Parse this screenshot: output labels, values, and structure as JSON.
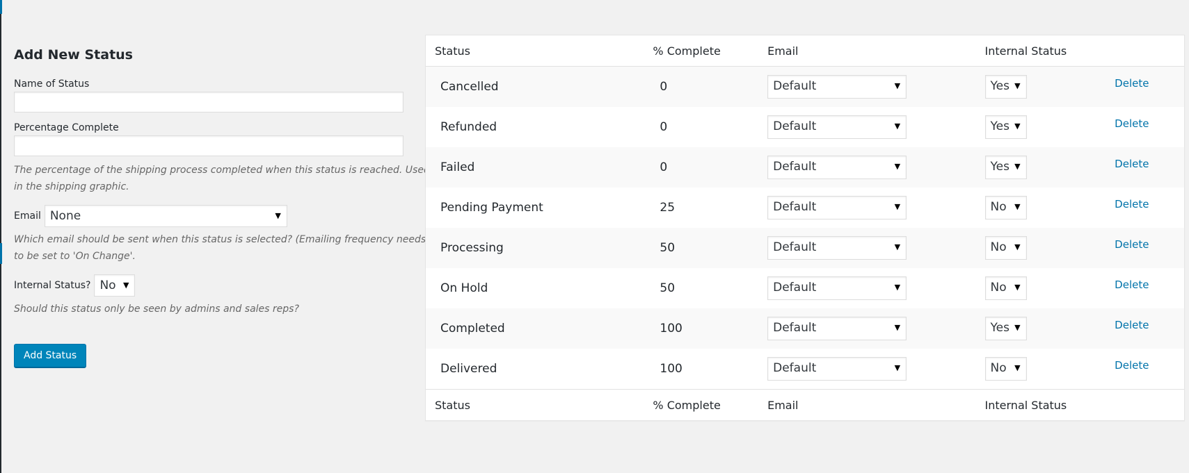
{
  "form": {
    "title": "Add New Status",
    "name_label": "Name of Status",
    "name_value": "",
    "percentage_label": "Percentage Complete",
    "percentage_value": "",
    "percentage_help": "The percentage of the shipping process completed when this status is reached. Used in the shipping graphic.",
    "email_label": "Email",
    "email_selected": "None",
    "email_help": "Which email should be sent when this status is selected? (Emailing frequency needs to be set to 'On Change'.",
    "internal_label": "Internal Status?",
    "internal_selected": "No",
    "internal_help": "Should this status only be seen by admins and sales reps?",
    "submit_label": "Add Status"
  },
  "table": {
    "headers": {
      "status": "Status",
      "pct": "% Complete",
      "email": "Email",
      "internal": "Internal Status"
    },
    "delete_label": "Delete",
    "rows": [
      {
        "status": "Cancelled",
        "pct": "0",
        "email": "Default",
        "internal": "Yes"
      },
      {
        "status": "Refunded",
        "pct": "0",
        "email": "Default",
        "internal": "Yes"
      },
      {
        "status": "Failed",
        "pct": "0",
        "email": "Default",
        "internal": "Yes"
      },
      {
        "status": "Pending Payment",
        "pct": "25",
        "email": "Default",
        "internal": "No"
      },
      {
        "status": "Processing",
        "pct": "50",
        "email": "Default",
        "internal": "No"
      },
      {
        "status": "On Hold",
        "pct": "50",
        "email": "Default",
        "internal": "No"
      },
      {
        "status": "Completed",
        "pct": "100",
        "email": "Default",
        "internal": "Yes"
      },
      {
        "status": "Delivered",
        "pct": "100",
        "email": "Default",
        "internal": "No"
      }
    ]
  },
  "icons": {
    "select_arrow": "▼"
  },
  "colors": {
    "primary_button": "#0085ba",
    "link": "#0073aa",
    "background": "#f1f1f1"
  }
}
